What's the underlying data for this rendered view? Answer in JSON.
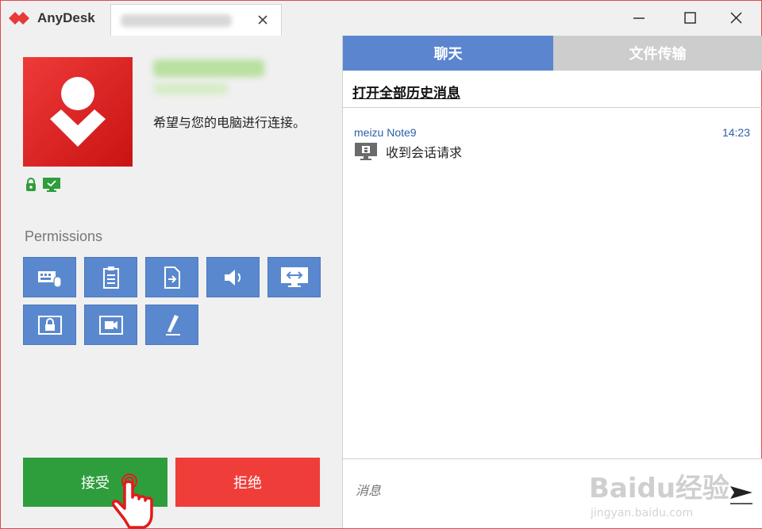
{
  "app": {
    "name": "AnyDesk"
  },
  "window": {
    "controls": [
      "minimize-icon",
      "maximize-icon",
      "close-icon"
    ]
  },
  "incoming": {
    "request_text": "希望与您的电脑进行连接。",
    "status_icons": [
      "lock-icon",
      "monitor-icon"
    ]
  },
  "permissions": {
    "title": "Permissions",
    "items": [
      {
        "icon": "keyboard-mouse-icon"
      },
      {
        "icon": "clipboard-icon"
      },
      {
        "icon": "file-transfer-icon"
      },
      {
        "icon": "sound-icon"
      },
      {
        "icon": "control-monitor-icon"
      },
      {
        "icon": "lock-screen-icon"
      },
      {
        "icon": "record-session-icon"
      },
      {
        "icon": "draw-icon"
      }
    ]
  },
  "actions": {
    "accept": "接受",
    "reject": "拒绝"
  },
  "chat": {
    "tabs": {
      "chat": "聊天",
      "files": "文件传输"
    },
    "history_link": "打开全部历史消息",
    "messages": [
      {
        "sender": "meizu Note9",
        "time": "14:23",
        "text": "收到会话请求"
      }
    ],
    "input_placeholder": "消息",
    "watermark_top": "Baidu经验",
    "watermark_bottom": "jingyan.baidu.com"
  },
  "colors": {
    "brand_red": "#ef3a3a",
    "accept_green": "#2e9d3c",
    "reject_red": "#ef3e3a",
    "chat_tab_blue": "#5b85cf",
    "permission_blue": "#5a88ce"
  }
}
